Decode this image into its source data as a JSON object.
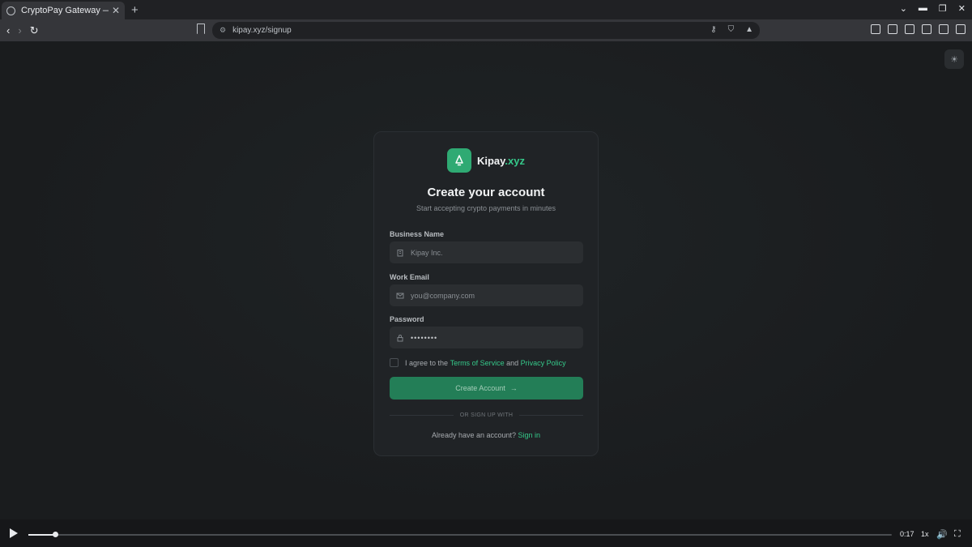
{
  "browser": {
    "tab_title": "CryptoPay Gateway — Mi",
    "tab_close": "✕",
    "new_tab": "+",
    "url": "kipay.xyz/signup"
  },
  "app": {
    "brand": "Kipay",
    "brand_tld": ".xyz",
    "title": "Create your account",
    "subtitle": "Start accepting crypto payments in minutes",
    "business_label": "Business Name",
    "business_placeholder": "Kipay Inc.",
    "email_label": "Work Email",
    "email_placeholder": "you@company.com",
    "password_label": "Password",
    "password_value": "••••••••",
    "agree_prefix": "I agree to the",
    "terms_link": "Terms of Service",
    "agree_and": "and",
    "privacy_link": "Privacy Policy",
    "submit_label": "Create Account",
    "submit_arrow": "→",
    "divider_text": "OR SIGN UP WITH",
    "signin_prompt": "Already have an account?",
    "signin_link": "Sign in",
    "accent_color": "#35c98a"
  },
  "player": {
    "time": "0:17",
    "speed": "1x",
    "progress": 0.031
  }
}
